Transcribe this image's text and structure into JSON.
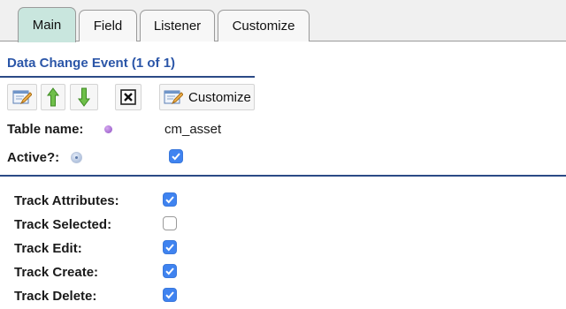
{
  "tabs": [
    {
      "label": "Main",
      "active": true
    },
    {
      "label": "Field",
      "active": false
    },
    {
      "label": "Listener",
      "active": false
    },
    {
      "label": "Customize",
      "active": false
    }
  ],
  "form": {
    "title": "Data Change Event (1 of 1)"
  },
  "toolbar": {
    "customize_label": "Customize",
    "icons": [
      "edit-icon",
      "arrow-up-icon",
      "arrow-down-icon",
      "delete-icon",
      "customize-icon"
    ]
  },
  "fields": {
    "table_name": {
      "label": "Table name:",
      "value": "cm_asset"
    },
    "active": {
      "label": "Active?:",
      "checked": true
    }
  },
  "tracking": [
    {
      "label": "Track Attributes:",
      "checked": true
    },
    {
      "label": "Track Selected:",
      "checked": false
    },
    {
      "label": "Track Edit:",
      "checked": true
    },
    {
      "label": "Track Create:",
      "checked": true
    },
    {
      "label": "Track Delete:",
      "checked": true
    }
  ],
  "colors": {
    "active_tab": "#c9e6de",
    "title_blue": "#2b56a8",
    "checkbox_blue": "#3f83f0",
    "divider": "#2b4a86"
  }
}
